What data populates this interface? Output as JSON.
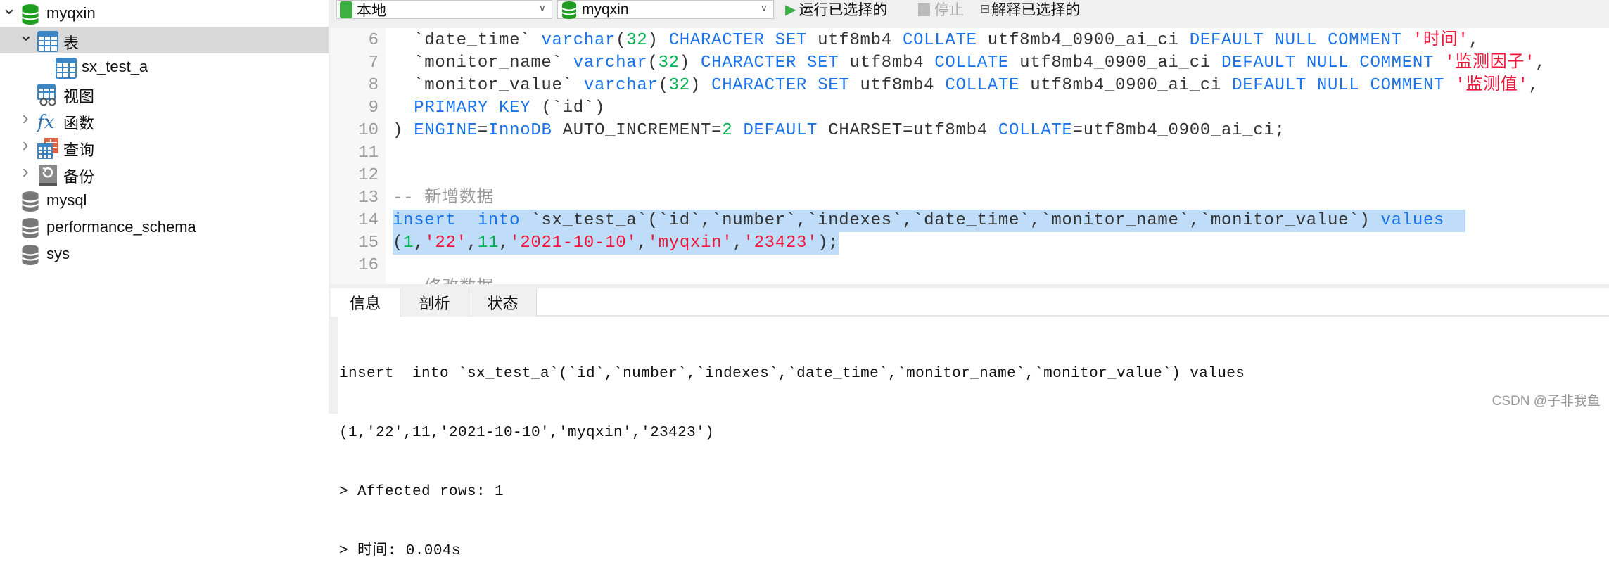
{
  "sidebar": {
    "items": [
      {
        "label": "myqxin",
        "icon": "database-icon-green",
        "expanded": true
      },
      {
        "label": "表",
        "icon": "table-icon",
        "expanded": true,
        "selected": true
      },
      {
        "label": "sx_test_a",
        "icon": "table-icon"
      },
      {
        "label": "视图",
        "icon": "view-icon"
      },
      {
        "label": "函数",
        "icon": "function-icon",
        "expanded": false
      },
      {
        "label": "查询",
        "icon": "query-icon",
        "expanded": false
      },
      {
        "label": "备份",
        "icon": "backup-icon",
        "expanded": false
      },
      {
        "label": "mysql",
        "icon": "database-icon-gray"
      },
      {
        "label": "performance_schema",
        "icon": "database-icon-gray"
      },
      {
        "label": "sys",
        "icon": "database-icon-gray"
      }
    ]
  },
  "toolbar": {
    "connection": "本地",
    "database": "myqxin",
    "run_selected": "运行已选择的",
    "stop": "停止",
    "explain_selected": "解释已选择的"
  },
  "colors": {
    "keyword": "#1a73e8",
    "number": "#00b050",
    "string": "#f0163a",
    "comment": "#9a9a9a",
    "text": "#333333",
    "selection": "#bfdcf8"
  },
  "editor": {
    "lines": [
      {
        "n": "6",
        "tokens": [
          [
            "  `date_time` ",
            "t"
          ],
          [
            "varchar",
            "k"
          ],
          [
            "(",
            "t"
          ],
          [
            "32",
            "n"
          ],
          [
            ") ",
            "t"
          ],
          [
            "CHARACTER SET",
            "k"
          ],
          [
            " utf8mb4 ",
            "t"
          ],
          [
            "COLLATE",
            "k"
          ],
          [
            " utf8mb4_0900_ai_ci ",
            "t"
          ],
          [
            "DEFAULT NULL COMMENT",
            "k"
          ],
          [
            " ",
            "t"
          ],
          [
            "'时间'",
            "s"
          ],
          [
            ",",
            "t"
          ]
        ]
      },
      {
        "n": "7",
        "tokens": [
          [
            "  `monitor_name` ",
            "t"
          ],
          [
            "varchar",
            "k"
          ],
          [
            "(",
            "t"
          ],
          [
            "32",
            "n"
          ],
          [
            ") ",
            "t"
          ],
          [
            "CHARACTER SET",
            "k"
          ],
          [
            " utf8mb4 ",
            "t"
          ],
          [
            "COLLATE",
            "k"
          ],
          [
            " utf8mb4_0900_ai_ci ",
            "t"
          ],
          [
            "DEFAULT NULL COMMENT",
            "k"
          ],
          [
            " ",
            "t"
          ],
          [
            "'监测因子'",
            "s"
          ],
          [
            ",",
            "t"
          ]
        ]
      },
      {
        "n": "8",
        "tokens": [
          [
            "  `monitor_value` ",
            "t"
          ],
          [
            "varchar",
            "k"
          ],
          [
            "(",
            "t"
          ],
          [
            "32",
            "n"
          ],
          [
            ") ",
            "t"
          ],
          [
            "CHARACTER SET",
            "k"
          ],
          [
            " utf8mb4 ",
            "t"
          ],
          [
            "COLLATE",
            "k"
          ],
          [
            " utf8mb4_0900_ai_ci ",
            "t"
          ],
          [
            "DEFAULT NULL COMMENT",
            "k"
          ],
          [
            " ",
            "t"
          ],
          [
            "'监测值'",
            "s"
          ],
          [
            ",",
            "t"
          ]
        ]
      },
      {
        "n": "9",
        "tokens": [
          [
            "  ",
            "t"
          ],
          [
            "PRIMARY KEY",
            "k"
          ],
          [
            " (`id`)",
            "t"
          ]
        ]
      },
      {
        "n": "10",
        "tokens": [
          [
            ") ",
            "t"
          ],
          [
            "ENGINE",
            "k"
          ],
          [
            "=",
            "t"
          ],
          [
            "InnoDB",
            "k"
          ],
          [
            " AUTO_INCREMENT=",
            "t"
          ],
          [
            "2",
            "n"
          ],
          [
            " ",
            "t"
          ],
          [
            "DEFAULT",
            "k"
          ],
          [
            " CHARSET=utf8mb4 ",
            "t"
          ],
          [
            "COLLATE",
            "k"
          ],
          [
            "=utf8mb4_0900_ai_ci;",
            "t"
          ]
        ]
      },
      {
        "n": "11",
        "tokens": []
      },
      {
        "n": "12",
        "tokens": []
      },
      {
        "n": "13",
        "tokens": [
          [
            "-- 新增数据",
            "c"
          ]
        ]
      },
      {
        "n": "14",
        "sel": true,
        "tokens": [
          [
            "insert  into",
            "k"
          ],
          [
            " `sx_test_a`(`id`,`number`,`indexes`,`date_time`,`monitor_name`,`monitor_value`) ",
            "t"
          ],
          [
            "values",
            "k"
          ],
          [
            "  ",
            "t"
          ]
        ]
      },
      {
        "n": "15",
        "sel": true,
        "tokens": [
          [
            "(",
            "t"
          ],
          [
            "1",
            "n"
          ],
          [
            ",",
            "t"
          ],
          [
            "'22'",
            "s"
          ],
          [
            ",",
            "t"
          ],
          [
            "11",
            "n"
          ],
          [
            ",",
            "t"
          ],
          [
            "'2021-10-10'",
            "s"
          ],
          [
            ",",
            "t"
          ],
          [
            "'myqxin'",
            "s"
          ],
          [
            ",",
            "t"
          ],
          [
            "'23423'",
            "s"
          ],
          [
            ");",
            "t"
          ]
        ]
      },
      {
        "n": "16",
        "tokens": []
      },
      {
        "n": "",
        "tokens": [
          [
            "-- 修改数据",
            "c"
          ]
        ]
      }
    ]
  },
  "result_tabs": [
    "信息",
    "剖析",
    "状态"
  ],
  "output": {
    "lines": [
      "insert  into `sx_test_a`(`id`,`number`,`indexes`,`date_time`,`monitor_name`,`monitor_value`) values",
      "(1,'22',11,'2021-10-10','myqxin','23423')",
      "> Affected rows: 1",
      "> 时间: 0.004s"
    ]
  },
  "watermark": "CSDN @子非我鱼"
}
